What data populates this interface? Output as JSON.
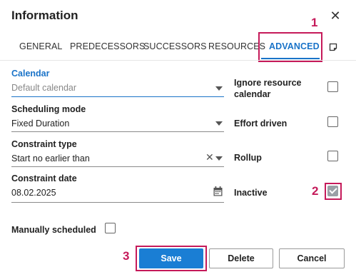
{
  "dialog": {
    "title": "Information"
  },
  "tabs": [
    {
      "label": "GENERAL"
    },
    {
      "label": "PREDECESSORS"
    },
    {
      "label": "SUCCESSORS"
    },
    {
      "label": "RESOURCES"
    },
    {
      "label": "ADVANCED",
      "active": true
    }
  ],
  "markers": {
    "one": "1",
    "two": "2",
    "three": "3"
  },
  "fields": {
    "calendar": {
      "label": "Calendar",
      "placeholder": "Default calendar"
    },
    "scheduling_mode": {
      "label": "Scheduling mode",
      "value": "Fixed Duration"
    },
    "constraint_type": {
      "label": "Constraint type",
      "value": "Start no earlier than"
    },
    "constraint_date": {
      "label": "Constraint date",
      "value": "08.02.2025"
    },
    "manually_scheduled": {
      "label": "Manually scheduled",
      "checked": false
    }
  },
  "options": {
    "ignore_resource_calendar": {
      "label_line1": "Ignore resource",
      "label_line2": "calendar",
      "checked": false
    },
    "effort_driven": {
      "label": "Effort driven",
      "checked": false
    },
    "rollup": {
      "label": "Rollup",
      "checked": false
    },
    "inactive": {
      "label": "Inactive",
      "checked": true
    }
  },
  "buttons": {
    "save": "Save",
    "delete": "Delete",
    "cancel": "Cancel"
  },
  "icons": {
    "close": "close-icon",
    "note": "note-icon",
    "calendar": "calendar-icon",
    "clear": "clear-icon",
    "dropdown": "chevron-down-icon"
  },
  "colors": {
    "accent": "#1a73c8",
    "save_button": "#1a7ed4",
    "highlight": "#c51a5a",
    "checked_box": "#9aa0a6"
  }
}
